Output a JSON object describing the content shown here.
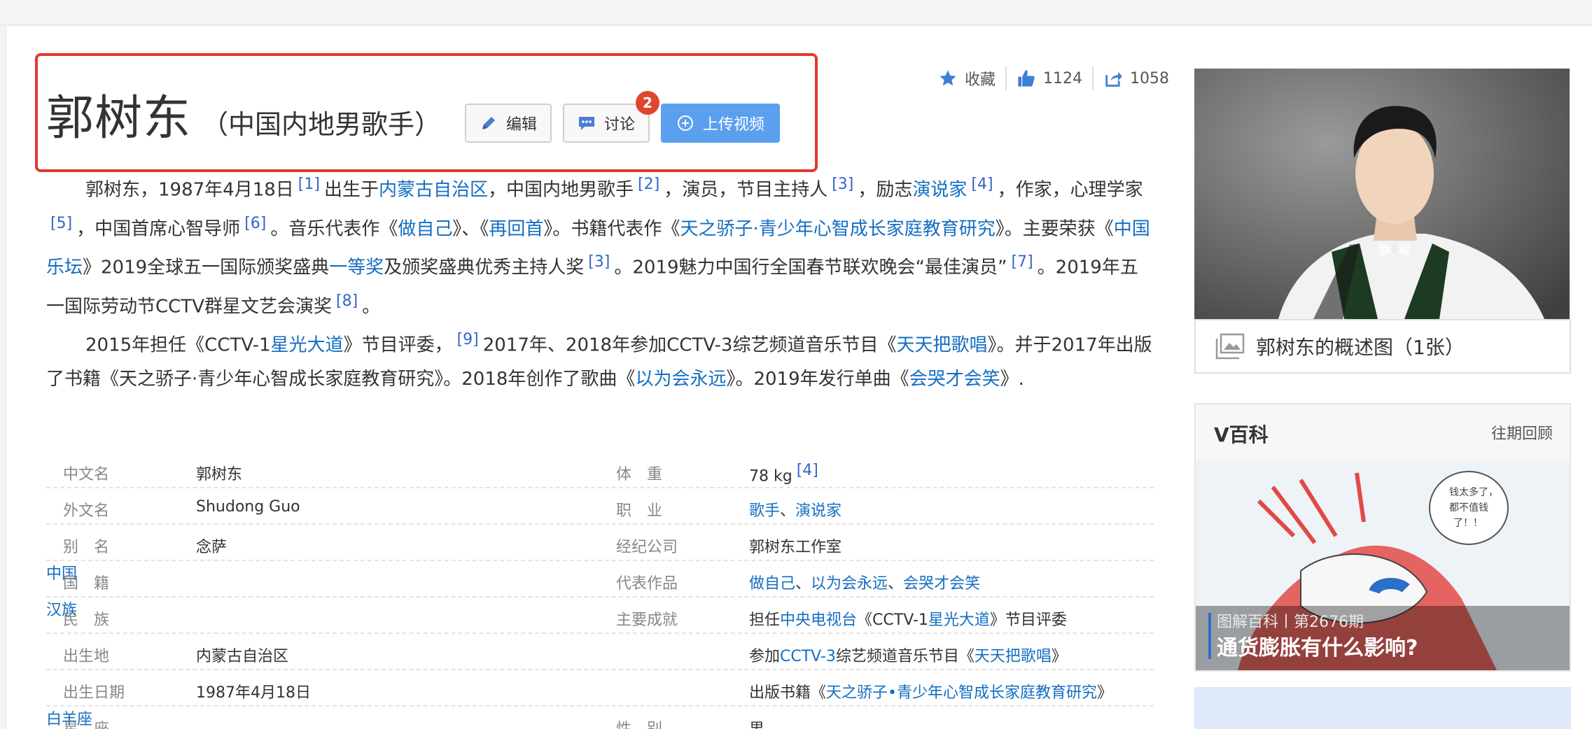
{
  "entry": {
    "title": "郭树东",
    "subtitle": "（中国内地男歌手）",
    "edit": "编辑",
    "discuss": "讨论",
    "discuss_badge": "2",
    "upload_video": "上传视频"
  },
  "actions": {
    "favorite": "收藏",
    "like_count": "1124",
    "share_count": "1058"
  },
  "summary": {
    "p1_t1": "郭树东，1987年4月18日",
    "p1_r1": "[1]",
    "p1_t2": "出生于",
    "p1_l1": "内蒙古自治区",
    "p1_t3": "，中国内地男歌手",
    "p1_r2": "[2]",
    "p1_t4": "，演员，节目主持人",
    "p1_r3": "[3]",
    "p1_t5": "，励志",
    "p1_l2": "演说家",
    "p1_r4": "[4]",
    "p1_t6": "，作家，心理学家",
    "p1_r5": "[5]",
    "p1_t7": "，中国首席心智导师",
    "p1_r6": "[6]",
    "p1_t8": "。音乐代表作《",
    "p1_l3": "做自己",
    "p1_t9": "》、《",
    "p1_l4": "再回首",
    "p1_t10": "》。书籍代表作《",
    "p1_l5": "天之骄子·青少年心智成长家庭教育研究",
    "p1_t11": "》。主要荣获《",
    "p1_l6": "中国乐坛",
    "p1_t12": "》2019全球五一国际颁奖盛典",
    "p1_l7": "一等奖",
    "p1_t13": "及颁奖盛典优秀主持人奖",
    "p1_r7": "[3]",
    "p1_t14": "。2019魅力中国行全国春节联欢晚会“最佳演员”",
    "p1_r8": "[7]",
    "p1_t15": "。2019年五一国际劳动节CCTV群星文艺会演奖",
    "p1_r9": "[8]",
    "p1_t16": "。",
    "p2_t1": "2015年担任《CCTV-1",
    "p2_l1": "星光大道",
    "p2_t2": "》节目评委，",
    "p2_r1": "[9]",
    "p2_t3": "2017年、2018年参加CCTV-3综艺频道音乐节目《",
    "p2_l2": "天天把歌唱",
    "p2_t4": "》。并于2017年出版了书籍《天之骄子·青少年心智成长家庭教育研究》。2018年创作了歌曲《",
    "p2_l3": "以为会永远",
    "p2_t5": "》。2019年发行单曲《",
    "p2_l4": "会哭才会笑",
    "p2_t6": "》."
  },
  "infobox": {
    "r1": {
      "l1": "中文名",
      "v1": "郭树东",
      "l2": "体　重",
      "v2": "78 kg",
      "v2_ref": "[4]"
    },
    "r2": {
      "l1": "外文名",
      "v1": "Shudong Guo",
      "l2": "职　业",
      "v2a": "歌手",
      "sep": "、",
      "v2b": "演说家"
    },
    "r3": {
      "l1": "别　名",
      "v1": "念萨",
      "l2": "经纪公司",
      "v2": "郭树东工作室"
    },
    "r4": {
      "l1": "国　籍",
      "v1": "中国",
      "l2": "代表作品",
      "v2a": "做自己",
      "sep1": "、",
      "v2b": "以为会永远",
      "sep2": "、",
      "v2c": "会哭才会笑"
    },
    "r5": {
      "l1": "民　族",
      "v1": "汉族",
      "l2": "主要成就",
      "t1": "担任",
      "lk1": "中央电视台",
      "t2": "《CCTV-1",
      "lk2": "星光大道",
      "t3": "》节目评委"
    },
    "r6": {
      "l1": "出生地",
      "v1": "内蒙古自治区",
      "t1": "参加",
      "lk1": "CCTV-3",
      "t2": "综艺频道音乐节目《",
      "lk2": "天天把歌唱",
      "t3": "》"
    },
    "r7": {
      "l1": "出生日期",
      "v1": "1987年4月18日",
      "t1": "出版书籍《",
      "lk1": "天之骄子•青少年心智成长家庭教育研究",
      "t2": "》"
    },
    "r8": {
      "l1": "星　座",
      "v1": "白羊座",
      "l2": "性　别",
      "v2": "男"
    }
  },
  "sidebar": {
    "photo_caption": "郭树东的概述图（1张）",
    "vbaike_title": "V百科",
    "vbaike_more": "往期回顾",
    "vbaike_series": "图解百科丨第2676期",
    "vbaike_headline": "通货膨胀有什么影响?",
    "bubble_text_1": "钱太多了，",
    "bubble_text_2": "都不值钱",
    "bubble_text_3": "了！！"
  },
  "colors": {
    "link": "#136ec2",
    "highlight_border": "#e03a2f",
    "upload_button": "#5ba0ef",
    "badge": "#e0462f"
  }
}
